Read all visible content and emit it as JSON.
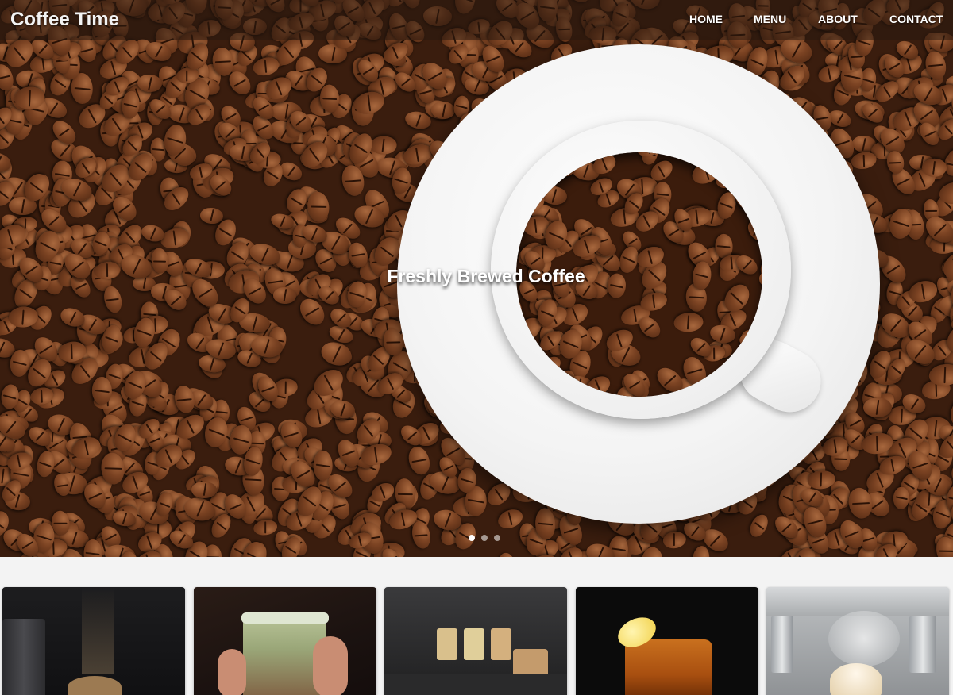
{
  "header": {
    "brand": "Coffee Time",
    "nav": [
      {
        "label": "HOME"
      },
      {
        "label": "MENU"
      },
      {
        "label": "ABOUT"
      },
      {
        "label": "CONTACT"
      }
    ]
  },
  "hero": {
    "caption": "Freshly Brewed Coffee",
    "slides_total": 3,
    "active_slide": 1
  },
  "gallery": {
    "items": [
      {
        "icon": "coffee-cups-photo"
      },
      {
        "icon": "iced-drink-photo"
      },
      {
        "icon": "coffee-bar-photo"
      },
      {
        "icon": "iced-tea-lemon-photo"
      },
      {
        "icon": "espresso-machine-photo"
      }
    ]
  },
  "colors": {
    "nav_bg": "#28180e",
    "page_bg": "#f3f3f3",
    "bean": "#7a4222"
  }
}
